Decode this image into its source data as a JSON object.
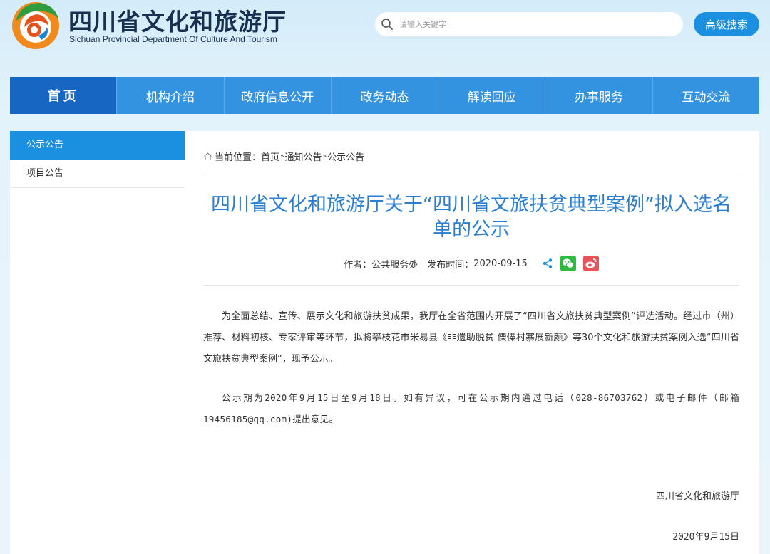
{
  "header": {
    "title_cn": "四川省文化和旅游厅",
    "title_en": "Sichuan Provincial Department Of Culture And Tourism",
    "search_placeholder": "请输入关键字",
    "advanced_search_label": "高级搜索"
  },
  "nav": {
    "items": [
      {
        "label": "首页",
        "active": true
      },
      {
        "label": "机构介绍"
      },
      {
        "label": "政府信息公开"
      },
      {
        "label": "政务动态"
      },
      {
        "label": "解读回应"
      },
      {
        "label": "办事服务"
      },
      {
        "label": "互动交流"
      }
    ]
  },
  "sidebar": {
    "items": [
      {
        "label": "公示公告",
        "active": true
      },
      {
        "label": "项目公告"
      }
    ]
  },
  "breadcrumb": {
    "prefix": "当前位置：",
    "items": [
      "首页",
      "通知公告",
      "公示公告"
    ],
    "separator": "»"
  },
  "article": {
    "title": "四川省文化和旅游厅关于“四川省文旅扶贫典型案例”拟入选名单的公示",
    "author": "作者：公共服务处",
    "publish_label": "发布时间：",
    "publish_date": "2020-09-15",
    "paragraphs": [
      "为全面总结、宣传、展示文化和旅游扶贫成果，我厅在全省范围内开展了“四川省文旅扶贫典型案例”评选活动。经过市（州）推荐、材料初核、专家评审等环节，拟将攀枝花市米易县《非遗助脱贫 傈僳村寨展新颜》等30个文化和旅游扶贫案例入选“四川省文旅扶贫典型案例”，现予公示。",
      "公示期为2020年9月15日至9月18日。如有异议，可在公示期内通过电话（028-86703762）或电子邮件（邮箱19456185@qq.com)提出意见。"
    ],
    "sign_org": "四川省文化和旅游厅",
    "sign_date": "2020年9月15日"
  },
  "icons": {
    "logo": "sichuan-culture-tourism-logo",
    "search": "search-icon",
    "home": "home-icon",
    "share": "share-icon",
    "wechat": "wechat-icon",
    "weibo": "weibo-icon"
  },
  "colors": {
    "nav_bg": "#3493e0",
    "nav_active": "#1766c2",
    "accent": "#1b8fe0",
    "title": "#2a7fd0",
    "wechat": "#2cba3f",
    "weibo": "#e8535b"
  }
}
